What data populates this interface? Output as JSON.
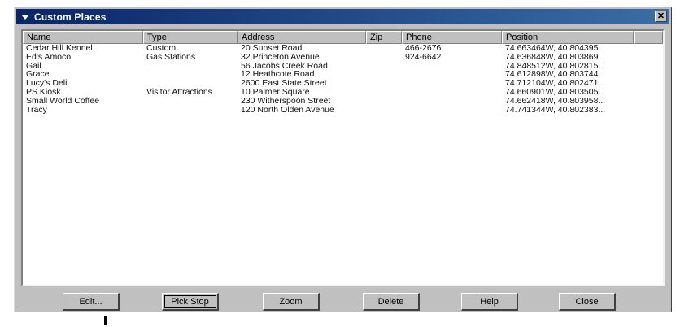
{
  "window": {
    "title": "Custom Places",
    "close_glyph": "✕"
  },
  "columns": [
    "Name",
    "Type",
    "Address",
    "Zip",
    "Phone",
    "Position"
  ],
  "rows": [
    [
      "Cedar Hill Kennel",
      "Custom",
      "20 Sunset Road",
      "",
      "466-2676",
      "74.663464W, 40.804395..."
    ],
    [
      "Ed's Amoco",
      "Gas Stations",
      "32 Princeton Avenue",
      "",
      "924-6642",
      "74.636848W, 40.803869..."
    ],
    [
      "Gail",
      "",
      "56 Jacobs Creek Road",
      "",
      "",
      "74.848512W, 40.802815..."
    ],
    [
      "Grace",
      "",
      "12 Heathcote Road",
      "",
      "",
      "74.612898W, 40.803744..."
    ],
    [
      "Lucy's Deli",
      "",
      "2600 East State Street",
      "",
      "",
      "74.712104W, 40.802471..."
    ],
    [
      "PS Kiosk",
      "Visitor Attractions",
      "10 Palmer Square",
      "",
      "",
      "74.660901W, 40.803505..."
    ],
    [
      "Small World Coffee",
      "",
      "230 Witherspoon Street",
      "",
      "",
      "74.662418W, 40.803958..."
    ],
    [
      "Tracy",
      "",
      "120 North Olden Avenue",
      "",
      "",
      "74.741344W, 40.802383..."
    ]
  ],
  "buttons": [
    "Edit...",
    "Pick Stop",
    "Zoom",
    "Delete",
    "Help",
    "Close"
  ]
}
